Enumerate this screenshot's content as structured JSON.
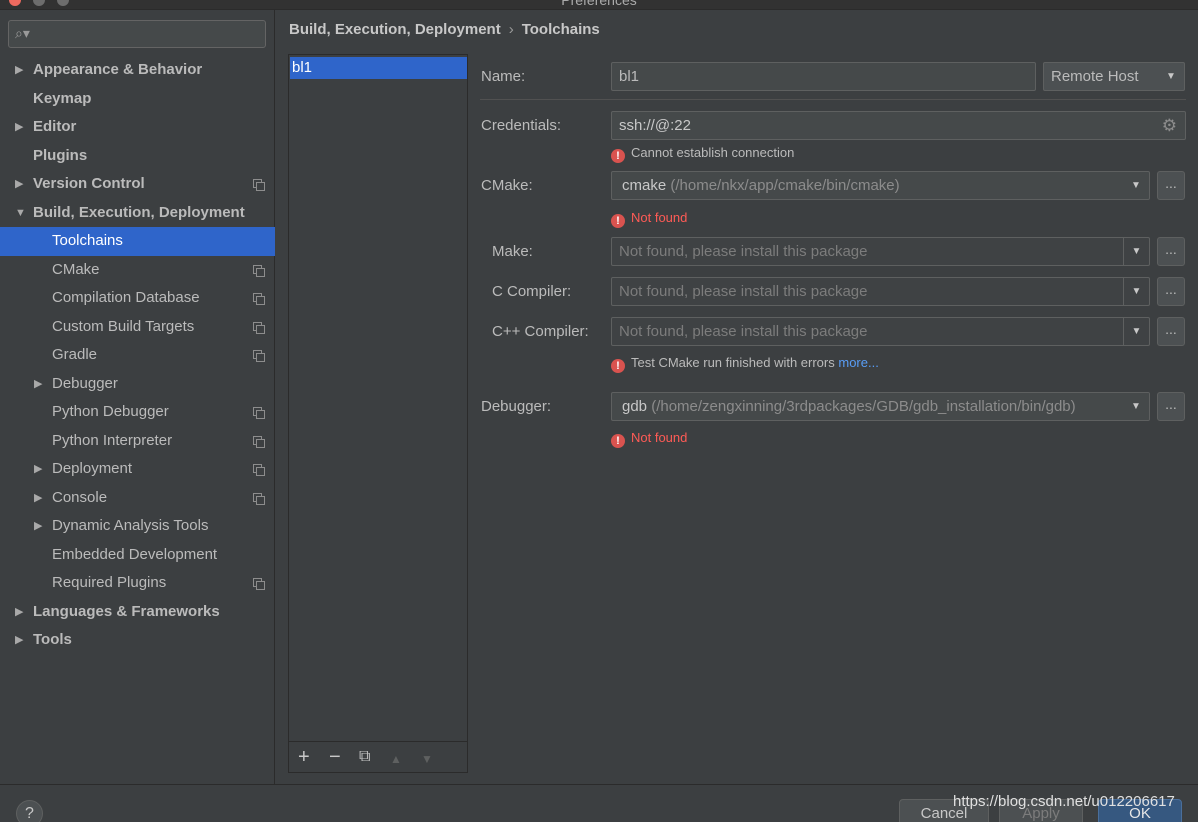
{
  "window": {
    "title": "Preferences"
  },
  "search": {
    "placeholder": ""
  },
  "sidebar": {
    "items": [
      {
        "label": "Appearance & Behavior",
        "arrow": "▶"
      },
      {
        "label": "Keymap"
      },
      {
        "label": "Editor",
        "arrow": "▶"
      },
      {
        "label": "Plugins"
      },
      {
        "label": "Version Control",
        "arrow": "▶"
      },
      {
        "label": "Build, Execution, Deployment",
        "arrow": "▼"
      },
      {
        "label": "Toolchains"
      },
      {
        "label": "CMake"
      },
      {
        "label": "Compilation Database"
      },
      {
        "label": "Custom Build Targets"
      },
      {
        "label": "Gradle"
      },
      {
        "label": "Debugger",
        "arrow": "▶"
      },
      {
        "label": "Python Debugger"
      },
      {
        "label": "Python Interpreter"
      },
      {
        "label": "Deployment",
        "arrow": "▶"
      },
      {
        "label": "Console",
        "arrow": "▶"
      },
      {
        "label": "Dynamic Analysis Tools",
        "arrow": "▶"
      },
      {
        "label": "Embedded Development"
      },
      {
        "label": "Required Plugins"
      },
      {
        "label": "Languages & Frameworks",
        "arrow": "▶"
      },
      {
        "label": "Tools",
        "arrow": "▶"
      }
    ]
  },
  "breadcrumb": {
    "parent": "Build, Execution, Deployment",
    "separator": "›",
    "current": "Toolchains"
  },
  "toolchains": {
    "items": [
      "bl1"
    ],
    "toolbar": {
      "add": "+",
      "remove": "−",
      "copy": "⧉",
      "up": "▲",
      "down": "▼"
    }
  },
  "form": {
    "name_label": "Name:",
    "name_value": "bl1",
    "env_value": "Remote Host",
    "credentials_label": "Credentials:",
    "credentials_value": "ssh://@:22",
    "credentials_error": "Cannot establish connection",
    "cmake_label": "CMake:",
    "cmake_name": "cmake",
    "cmake_path": "(/home/nkx/app/cmake/bin/cmake)",
    "cmake_error": "Not found",
    "make_label": "Make:",
    "make_value": "Not found, please install this package",
    "c_label": "C Compiler:",
    "c_value": "Not found, please install this package",
    "cpp_label": "C++ Compiler:",
    "cpp_value": "Not found, please install this package",
    "test_error": "Test CMake run finished with errors",
    "more_link": "more...",
    "debugger_label": "Debugger:",
    "debugger_name": "gdb",
    "debugger_path": "(/home/zengxinning/3rdpackages/GDB/gdb_installation/bin/gdb)",
    "debugger_error": "Not found",
    "browse_label": "...",
    "error_glyph": "!"
  },
  "footer": {
    "help": "?",
    "cancel": "Cancel",
    "apply": "Apply",
    "ok": "OK"
  },
  "watermark": "https://blog.csdn.net/u012206617",
  "colors": {
    "background": "#3c3f41",
    "selection": "#2f65ca",
    "error": "#ff5b56",
    "link": "#589df6",
    "ok_button": "#365880"
  }
}
